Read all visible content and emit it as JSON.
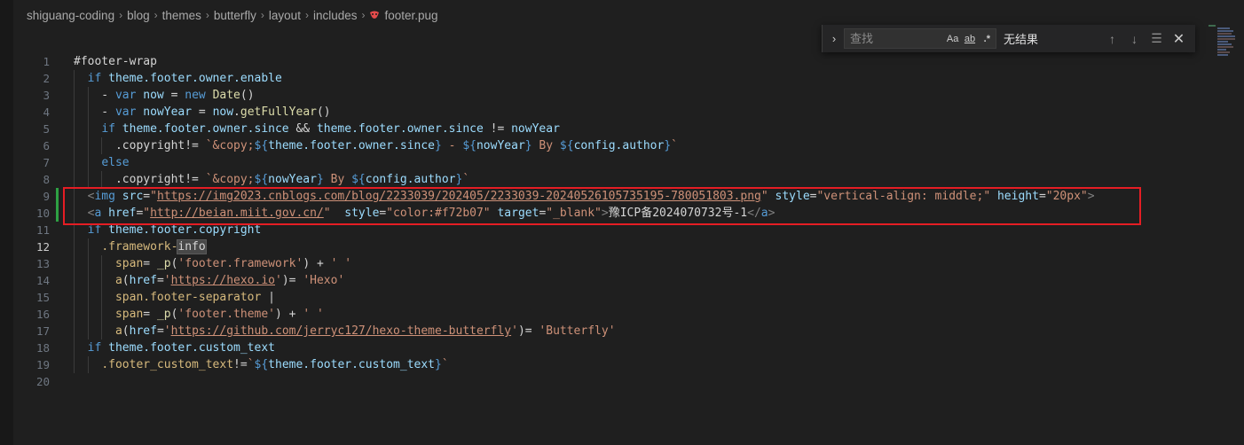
{
  "breadcrumb": [
    "shiguang-coding",
    "blog",
    "themes",
    "butterfly",
    "layout",
    "includes",
    "footer.pug"
  ],
  "find": {
    "placeholder": "查找",
    "match_case": "Aa",
    "whole_word": "ab",
    "regex": ".*",
    "result": "无结果"
  },
  "colors": {
    "editor_bg": "#1f1f1f",
    "highlight_box": "#e51d24",
    "modified_gutter": "#2ea043"
  },
  "lines": [
    [
      [
        "t-plain",
        "#footer-wrap"
      ]
    ],
    [
      [
        "t-plain",
        "  "
      ],
      [
        "t-kw",
        "if"
      ],
      [
        "t-plain",
        " "
      ],
      [
        "t-var",
        "theme.footer.owner.enable"
      ]
    ],
    [
      [
        "t-plain",
        "    - "
      ],
      [
        "t-kw",
        "var"
      ],
      [
        "t-plain",
        " "
      ],
      [
        "t-var",
        "now"
      ],
      [
        "t-plain",
        " = "
      ],
      [
        "t-kw",
        "new"
      ],
      [
        "t-plain",
        " "
      ],
      [
        "t-fn",
        "Date"
      ],
      [
        "t-plain",
        "()"
      ]
    ],
    [
      [
        "t-plain",
        "    - "
      ],
      [
        "t-kw",
        "var"
      ],
      [
        "t-plain",
        " "
      ],
      [
        "t-var",
        "nowYear"
      ],
      [
        "t-plain",
        " = "
      ],
      [
        "t-var",
        "now"
      ],
      [
        "t-plain",
        "."
      ],
      [
        "t-fn",
        "getFullYear"
      ],
      [
        "t-plain",
        "()"
      ]
    ],
    [
      [
        "t-plain",
        "    "
      ],
      [
        "t-kw",
        "if"
      ],
      [
        "t-plain",
        " "
      ],
      [
        "t-var",
        "theme.footer.owner.since"
      ],
      [
        "t-plain",
        " && "
      ],
      [
        "t-var",
        "theme.footer.owner.since"
      ],
      [
        "t-plain",
        " != "
      ],
      [
        "t-var",
        "nowYear"
      ]
    ],
    [
      [
        "t-plain",
        "      .copyright!= "
      ],
      [
        "t-str",
        "`&copy;"
      ],
      [
        "t-brace",
        "${"
      ],
      [
        "t-var",
        "theme.footer.owner.since"
      ],
      [
        "t-brace",
        "}"
      ],
      [
        "t-str",
        " - "
      ],
      [
        "t-brace",
        "${"
      ],
      [
        "t-var",
        "nowYear"
      ],
      [
        "t-brace",
        "}"
      ],
      [
        "t-str",
        " By "
      ],
      [
        "t-brace",
        "${"
      ],
      [
        "t-var",
        "config.author"
      ],
      [
        "t-brace",
        "}"
      ],
      [
        "t-str",
        "`"
      ]
    ],
    [
      [
        "t-plain",
        "    "
      ],
      [
        "t-kw",
        "else"
      ]
    ],
    [
      [
        "t-plain",
        "      .copyright!= "
      ],
      [
        "t-str",
        "`&copy;"
      ],
      [
        "t-brace",
        "${"
      ],
      [
        "t-var",
        "nowYear"
      ],
      [
        "t-brace",
        "}"
      ],
      [
        "t-str",
        " By "
      ],
      [
        "t-brace",
        "${"
      ],
      [
        "t-var",
        "config.author"
      ],
      [
        "t-brace",
        "}"
      ],
      [
        "t-str",
        "`"
      ]
    ],
    [
      [
        "t-plain",
        "  "
      ],
      [
        "t-tag",
        "<"
      ],
      [
        "t-tagname",
        "img"
      ],
      [
        "t-plain",
        " "
      ],
      [
        "t-attr",
        "src"
      ],
      [
        "t-plain",
        "="
      ],
      [
        "t-str",
        "\""
      ],
      [
        "t-link",
        "https://img2023.cnblogs.com/blog/2233039/202405/2233039-20240526105735195-780051803.png"
      ],
      [
        "t-str",
        "\""
      ],
      [
        "t-plain",
        " "
      ],
      [
        "t-attr",
        "style"
      ],
      [
        "t-plain",
        "="
      ],
      [
        "t-str",
        "\"vertical-align: middle;\""
      ],
      [
        "t-plain",
        " "
      ],
      [
        "t-attr",
        "height"
      ],
      [
        "t-plain",
        "="
      ],
      [
        "t-str",
        "\"20px\""
      ],
      [
        "t-tag",
        ">"
      ]
    ],
    [
      [
        "t-plain",
        "  "
      ],
      [
        "t-tag",
        "<"
      ],
      [
        "t-tagname",
        "a"
      ],
      [
        "t-plain",
        " "
      ],
      [
        "t-attr",
        "href"
      ],
      [
        "t-plain",
        "="
      ],
      [
        "t-str",
        "\""
      ],
      [
        "t-link",
        "http://beian.miit.gov.cn/"
      ],
      [
        "t-str",
        "\""
      ],
      [
        "t-plain",
        "  "
      ],
      [
        "t-attr",
        "style"
      ],
      [
        "t-plain",
        "="
      ],
      [
        "t-str",
        "\"color:#f72b07\""
      ],
      [
        "t-plain",
        " "
      ],
      [
        "t-attr",
        "target"
      ],
      [
        "t-plain",
        "="
      ],
      [
        "t-str",
        "\"_blank\""
      ],
      [
        "t-tag",
        ">"
      ],
      [
        "t-plain",
        "豫ICP备2024070732号-1"
      ],
      [
        "t-tag",
        "</"
      ],
      [
        "t-tagname",
        "a"
      ],
      [
        "t-tag",
        ">"
      ]
    ],
    [
      [
        "t-plain",
        "  "
      ],
      [
        "t-kw",
        "if"
      ],
      [
        "t-plain",
        " "
      ],
      [
        "t-var",
        "theme.footer.copyright"
      ]
    ],
    [
      [
        "t-plain",
        "    "
      ],
      [
        "t-sel",
        ".framework-"
      ],
      [
        "hl",
        "info"
      ],
      [
        "cur",
        ""
      ]
    ],
    [
      [
        "t-plain",
        "      "
      ],
      [
        "t-sel",
        "span"
      ],
      [
        "t-plain",
        "= "
      ],
      [
        "t-fn",
        "_p"
      ],
      [
        "t-plain",
        "("
      ],
      [
        "t-str",
        "'footer.framework'"
      ],
      [
        "t-plain",
        ") + "
      ],
      [
        "t-str",
        "' '"
      ]
    ],
    [
      [
        "t-plain",
        "      "
      ],
      [
        "t-sel",
        "a"
      ],
      [
        "t-plain",
        "("
      ],
      [
        "t-attr",
        "href"
      ],
      [
        "t-plain",
        "="
      ],
      [
        "t-str",
        "'"
      ],
      [
        "t-link",
        "https://hexo.io"
      ],
      [
        "t-str",
        "'"
      ],
      [
        "t-plain",
        ")= "
      ],
      [
        "t-str",
        "'Hexo'"
      ]
    ],
    [
      [
        "t-plain",
        "      "
      ],
      [
        "t-sel",
        "span.footer-separator"
      ],
      [
        "t-plain",
        " |"
      ]
    ],
    [
      [
        "t-plain",
        "      "
      ],
      [
        "t-sel",
        "span"
      ],
      [
        "t-plain",
        "= "
      ],
      [
        "t-fn",
        "_p"
      ],
      [
        "t-plain",
        "("
      ],
      [
        "t-str",
        "'footer.theme'"
      ],
      [
        "t-plain",
        ") + "
      ],
      [
        "t-str",
        "' '"
      ]
    ],
    [
      [
        "t-plain",
        "      "
      ],
      [
        "t-sel",
        "a"
      ],
      [
        "t-plain",
        "("
      ],
      [
        "t-attr",
        "href"
      ],
      [
        "t-plain",
        "="
      ],
      [
        "t-str",
        "'"
      ],
      [
        "t-link",
        "https://github.com/jerryc127/hexo-theme-butterfly"
      ],
      [
        "t-str",
        "'"
      ],
      [
        "t-plain",
        ")= "
      ],
      [
        "t-str",
        "'Butterfly'"
      ]
    ],
    [
      [
        "t-plain",
        "  "
      ],
      [
        "t-kw",
        "if"
      ],
      [
        "t-plain",
        " "
      ],
      [
        "t-var",
        "theme.footer.custom_text"
      ]
    ],
    [
      [
        "t-plain",
        "    "
      ],
      [
        "t-sel",
        ".footer_custom_text"
      ],
      [
        "t-plain",
        "!="
      ],
      [
        "t-str",
        "`"
      ],
      [
        "t-brace",
        "${"
      ],
      [
        "t-var",
        "theme.footer.custom_text"
      ],
      [
        "t-brace",
        "}"
      ],
      [
        "t-str",
        "`"
      ]
    ],
    []
  ],
  "line_numbers": [
    "1",
    "2",
    "3",
    "4",
    "5",
    "6",
    "7",
    "8",
    "9",
    "10",
    "11",
    "12",
    "13",
    "14",
    "15",
    "16",
    "17",
    "18",
    "19",
    "20"
  ],
  "active_line": 12,
  "modified_lines": [
    9,
    10
  ]
}
